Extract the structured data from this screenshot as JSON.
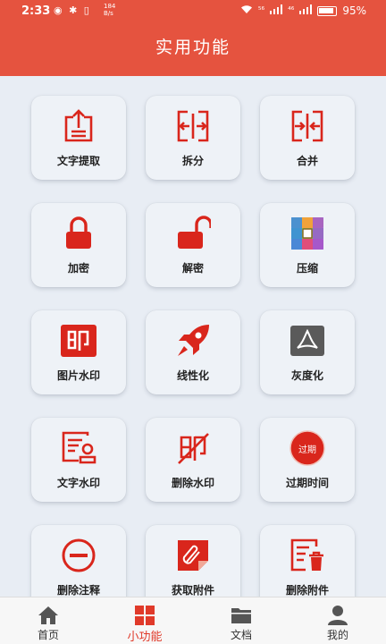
{
  "status_bar": {
    "time": "2:33",
    "speed_top": "184",
    "speed_bottom": "B/s",
    "signal1": "⁵⁶",
    "signal2": "⁴⁶",
    "battery": "95%"
  },
  "header": {
    "title": "实用功能"
  },
  "features": [
    {
      "label": "文字提取",
      "icon": "text-extract-icon"
    },
    {
      "label": "拆分",
      "icon": "split-icon"
    },
    {
      "label": "合并",
      "icon": "merge-icon"
    },
    {
      "label": "加密",
      "icon": "lock-closed-icon"
    },
    {
      "label": "解密",
      "icon": "lock-open-icon"
    },
    {
      "label": "压缩",
      "icon": "compress-icon"
    },
    {
      "label": "图片水印",
      "icon": "image-watermark-icon"
    },
    {
      "label": "线性化",
      "icon": "rocket-icon"
    },
    {
      "label": "灰度化",
      "icon": "grayscale-pdf-icon"
    },
    {
      "label": "文字水印",
      "icon": "text-watermark-icon"
    },
    {
      "label": "删除水印",
      "icon": "remove-watermark-icon"
    },
    {
      "label": "过期时间",
      "icon": "expire-time-icon",
      "badge": "过期"
    },
    {
      "label": "删除注释",
      "icon": "remove-annotation-icon"
    },
    {
      "label": "获取附件",
      "icon": "get-attachment-icon"
    },
    {
      "label": "删除附件",
      "icon": "remove-attachment-icon"
    }
  ],
  "tabs": [
    {
      "label": "首页",
      "icon": "home-icon"
    },
    {
      "label": "小功能",
      "icon": "grid-icon",
      "active": true
    },
    {
      "label": "文档",
      "icon": "folder-icon"
    },
    {
      "label": "我的",
      "icon": "user-icon"
    }
  ],
  "colors": {
    "accent": "#e5533f",
    "icon_red": "#d9261c",
    "active_tab": "#e03a2a",
    "background": "#e8edf4"
  }
}
